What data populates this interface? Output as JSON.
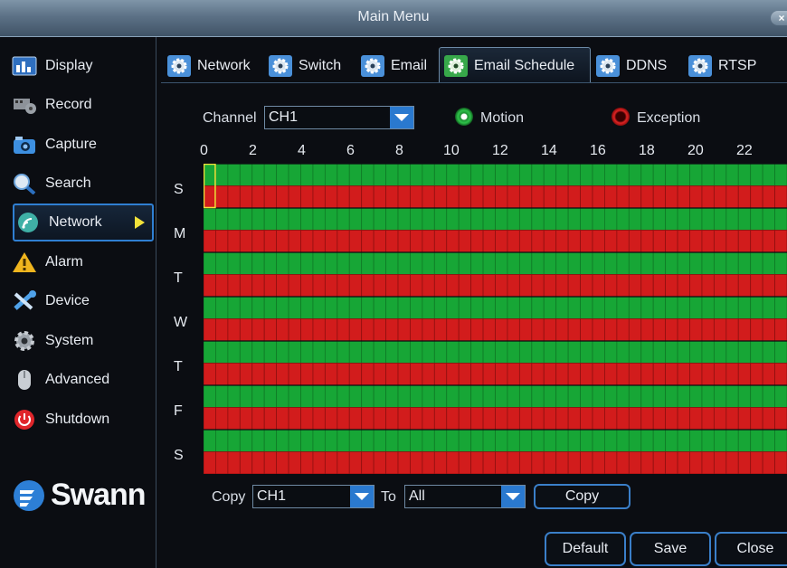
{
  "window": {
    "title": "Main Menu",
    "close_label": "×"
  },
  "sidebar": {
    "items": [
      {
        "label": "Display",
        "icon": "display-icon"
      },
      {
        "label": "Record",
        "icon": "record-icon"
      },
      {
        "label": "Capture",
        "icon": "camera-icon"
      },
      {
        "label": "Search",
        "icon": "search-icon"
      },
      {
        "label": "Network",
        "icon": "network-icon",
        "active": true
      },
      {
        "label": "Alarm",
        "icon": "alarm-icon"
      },
      {
        "label": "Device",
        "icon": "device-icon"
      },
      {
        "label": "System",
        "icon": "gear-icon"
      },
      {
        "label": "Advanced",
        "icon": "mouse-icon"
      },
      {
        "label": "Shutdown",
        "icon": "power-icon"
      }
    ],
    "logo": "Swann"
  },
  "tabs": [
    {
      "label": "Network"
    },
    {
      "label": "Switch"
    },
    {
      "label": "Email"
    },
    {
      "label": "Email Schedule",
      "active": true
    },
    {
      "label": "DDNS"
    },
    {
      "label": "RTSP"
    }
  ],
  "schedule": {
    "channel_label": "Channel",
    "channel_value": "CH1",
    "legend": [
      {
        "label": "Motion",
        "color": "#1fa83a"
      },
      {
        "label": "Exception",
        "color": "#d51a1a"
      }
    ],
    "hour_labels": [
      "0",
      "2",
      "4",
      "6",
      "8",
      "10",
      "12",
      "14",
      "16",
      "18",
      "20",
      "22"
    ],
    "days": [
      "S",
      "M",
      "T",
      "W",
      "T",
      "F",
      "S"
    ],
    "motion_color": "#17a636",
    "exception_color": "#d21c1c"
  },
  "copy": {
    "copy_label": "Copy",
    "from_value": "CH1",
    "to_label": "To",
    "to_value": "All",
    "copy_button": "Copy"
  },
  "footer": {
    "default_button": "Default",
    "save_button": "Save",
    "close_button": "Close"
  }
}
